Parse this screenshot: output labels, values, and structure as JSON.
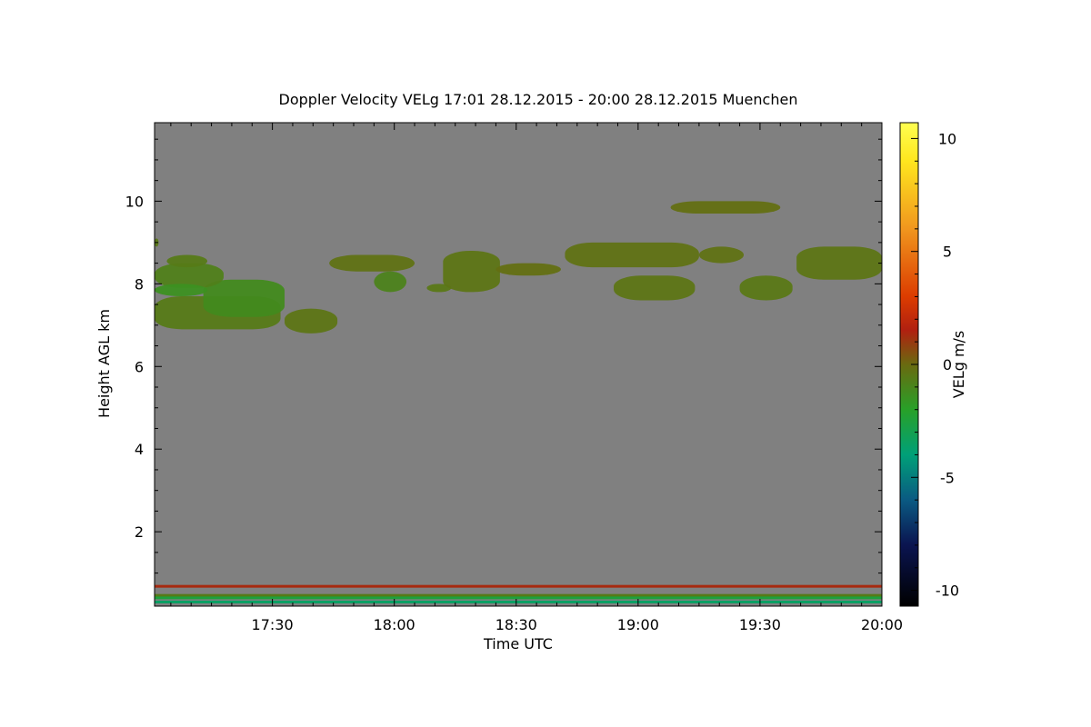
{
  "chart_data": {
    "type": "heatmap",
    "title": "Doppler Velocity VELg   17:01 28.12.2015 - 20:00 28.12.2015 Muenchen",
    "xlabel": "Time UTC",
    "ylabel": "Height AGL km",
    "colorbar_label": "VELg m/s",
    "xlim_minutes_utc": [
      1021,
      1200
    ],
    "ylim_km": [
      0.2,
      11.9
    ],
    "clim_ms": [
      -10.7,
      10.7
    ],
    "x_ticks": [
      {
        "minute": 1050,
        "label": "17:30"
      },
      {
        "minute": 1080,
        "label": "18:00"
      },
      {
        "minute": 1110,
        "label": "18:30"
      },
      {
        "minute": 1140,
        "label": "19:00"
      },
      {
        "minute": 1170,
        "label": "19:30"
      },
      {
        "minute": 1200,
        "label": "20:00"
      }
    ],
    "y_ticks": [
      2,
      4,
      6,
      8,
      10
    ],
    "colorbar_ticks": [
      10,
      5,
      0,
      -5,
      -10
    ],
    "colormap_stops": [
      {
        "v": -10.7,
        "c": "#000000"
      },
      {
        "v": -8,
        "c": "#0a1450"
      },
      {
        "v": -6,
        "c": "#0a5a82"
      },
      {
        "v": -4,
        "c": "#00a078"
      },
      {
        "v": -2,
        "c": "#28a028"
      },
      {
        "v": 0,
        "c": "#6a6a10"
      },
      {
        "v": 1.5,
        "c": "#b02010"
      },
      {
        "v": 3,
        "c": "#dc3c00"
      },
      {
        "v": 6,
        "c": "#f0961e"
      },
      {
        "v": 9,
        "c": "#ffe61e"
      },
      {
        "v": 10.7,
        "c": "#ffff50"
      }
    ],
    "background_color": "#808080",
    "cloud_layers": [
      {
        "t0": 1021,
        "t1": 1052,
        "h_bottom": 6.9,
        "h_top": 7.7,
        "velocity": -0.6
      },
      {
        "t0": 1033,
        "t1": 1053,
        "h_bottom": 7.2,
        "h_top": 8.1,
        "velocity": -1.2
      },
      {
        "t0": 1053,
        "t1": 1066,
        "h_bottom": 6.8,
        "h_top": 7.4,
        "velocity": -0.4
      },
      {
        "t0": 1021,
        "t1": 1038,
        "h_bottom": 7.9,
        "h_top": 8.5,
        "velocity": -0.8
      },
      {
        "t0": 1021,
        "t1": 1034,
        "h_bottom": 7.7,
        "h_top": 8.0,
        "velocity": -1.4
      },
      {
        "t0": 1024,
        "t1": 1034,
        "h_bottom": 8.4,
        "h_top": 8.7,
        "velocity": -0.6
      },
      {
        "t0": 1021,
        "t1": 1022,
        "h_bottom": 8.9,
        "h_top": 9.1,
        "velocity": -0.5
      },
      {
        "t0": 1064,
        "t1": 1085,
        "h_bottom": 8.3,
        "h_top": 8.7,
        "velocity": -0.3
      },
      {
        "t0": 1075,
        "t1": 1083,
        "h_bottom": 7.8,
        "h_top": 8.3,
        "velocity": -0.9
      },
      {
        "t0": 1088,
        "t1": 1094,
        "h_bottom": 7.8,
        "h_top": 8.0,
        "velocity": -0.5
      },
      {
        "t0": 1092,
        "t1": 1106,
        "h_bottom": 7.8,
        "h_top": 8.8,
        "velocity": -0.4
      },
      {
        "t0": 1105,
        "t1": 1121,
        "h_bottom": 8.2,
        "h_top": 8.5,
        "velocity": -0.2
      },
      {
        "t0": 1122,
        "t1": 1155,
        "h_bottom": 8.4,
        "h_top": 9.0,
        "velocity": -0.3
      },
      {
        "t0": 1148,
        "t1": 1175,
        "h_bottom": 9.7,
        "h_top": 10.0,
        "velocity": -0.2
      },
      {
        "t0": 1134,
        "t1": 1154,
        "h_bottom": 7.6,
        "h_top": 8.2,
        "velocity": -0.4
      },
      {
        "t0": 1155,
        "t1": 1166,
        "h_bottom": 8.5,
        "h_top": 8.9,
        "velocity": -0.3
      },
      {
        "t0": 1165,
        "t1": 1178,
        "h_bottom": 7.6,
        "h_top": 8.2,
        "velocity": -0.5
      },
      {
        "t0": 1179,
        "t1": 1200,
        "h_bottom": 8.1,
        "h_top": 8.9,
        "velocity": -0.4
      }
    ],
    "near_surface_bands": [
      {
        "h": 0.68,
        "velocity": 1.3
      },
      {
        "h": 0.46,
        "velocity": -0.6
      },
      {
        "h": 0.4,
        "velocity": -2.5
      },
      {
        "h": 0.3,
        "velocity": -3.5
      }
    ]
  }
}
